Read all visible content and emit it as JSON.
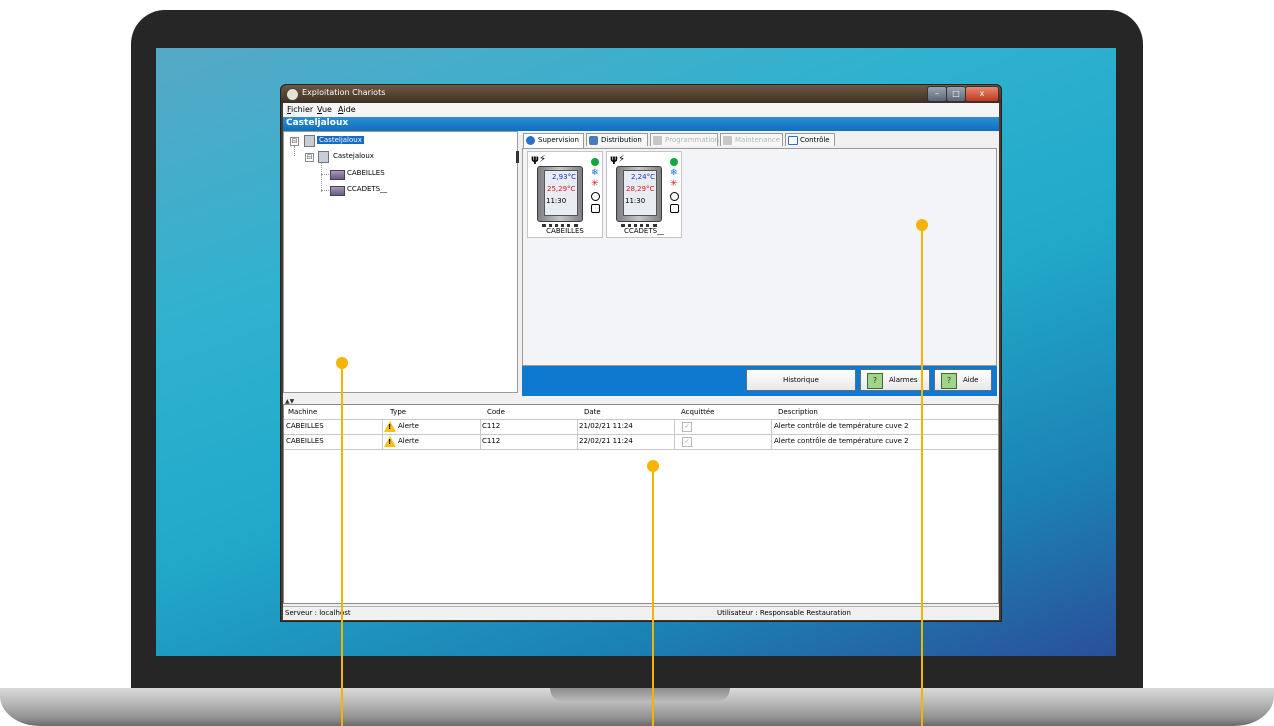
{
  "window": {
    "title": "Exploitation Chariots",
    "min": "–",
    "max": "□",
    "close": "x"
  },
  "menu": {
    "items": [
      "Fichier",
      "Vue",
      "Aide"
    ]
  },
  "header": {
    "site_title": "Casteljaloux"
  },
  "tree": {
    "root": "Casteljaloux",
    "group": "Castejaloux",
    "carts": [
      "CABEILLES",
      "CCADETS__"
    ],
    "collapse_symbol": "⊟"
  },
  "tabs": [
    {
      "label": "Supervision",
      "state": "active"
    },
    {
      "label": "Distribution",
      "state": "enabled"
    },
    {
      "label": "Programmation",
      "state": "disabled"
    },
    {
      "label": "Maintenance",
      "state": "disabled"
    },
    {
      "label": "Contrôle",
      "state": "enabled"
    }
  ],
  "carts": [
    {
      "name": "CABEILLES",
      "temp_cold": "2,93°C",
      "temp_hot": "25,29°C",
      "time": "11:30"
    },
    {
      "name": "CCADETS__",
      "temp_cold": "2,24°C",
      "temp_hot": "28,29°C",
      "time": "11:30"
    }
  ],
  "actions": {
    "history": "Historique",
    "alarms": "Alarmes",
    "help": "Aide"
  },
  "alarms": {
    "columns": [
      "Machine",
      "Type",
      "Code",
      "Date",
      "Acquittée",
      "Description"
    ],
    "rows": [
      {
        "machine": "CABEILLES",
        "type": "Alerte",
        "code": "C112",
        "date": "21/02/21 11:24",
        "ack": "✓",
        "description": "Alerte contrôle de température cuve 2"
      },
      {
        "machine": "CABEILLES",
        "type": "Alerte",
        "code": "C112",
        "date": "22/02/21 11:24",
        "ack": "✓",
        "description": "Alerte contrôle de température cuve 2"
      }
    ]
  },
  "status": {
    "server": "Serveur : localhost",
    "user": "Utilisateur : Responsable Restauration"
  },
  "colors": {
    "accent_blue": "#0f79cf",
    "callout": "#f5b400",
    "alert_yellow": "#f2c21b"
  }
}
